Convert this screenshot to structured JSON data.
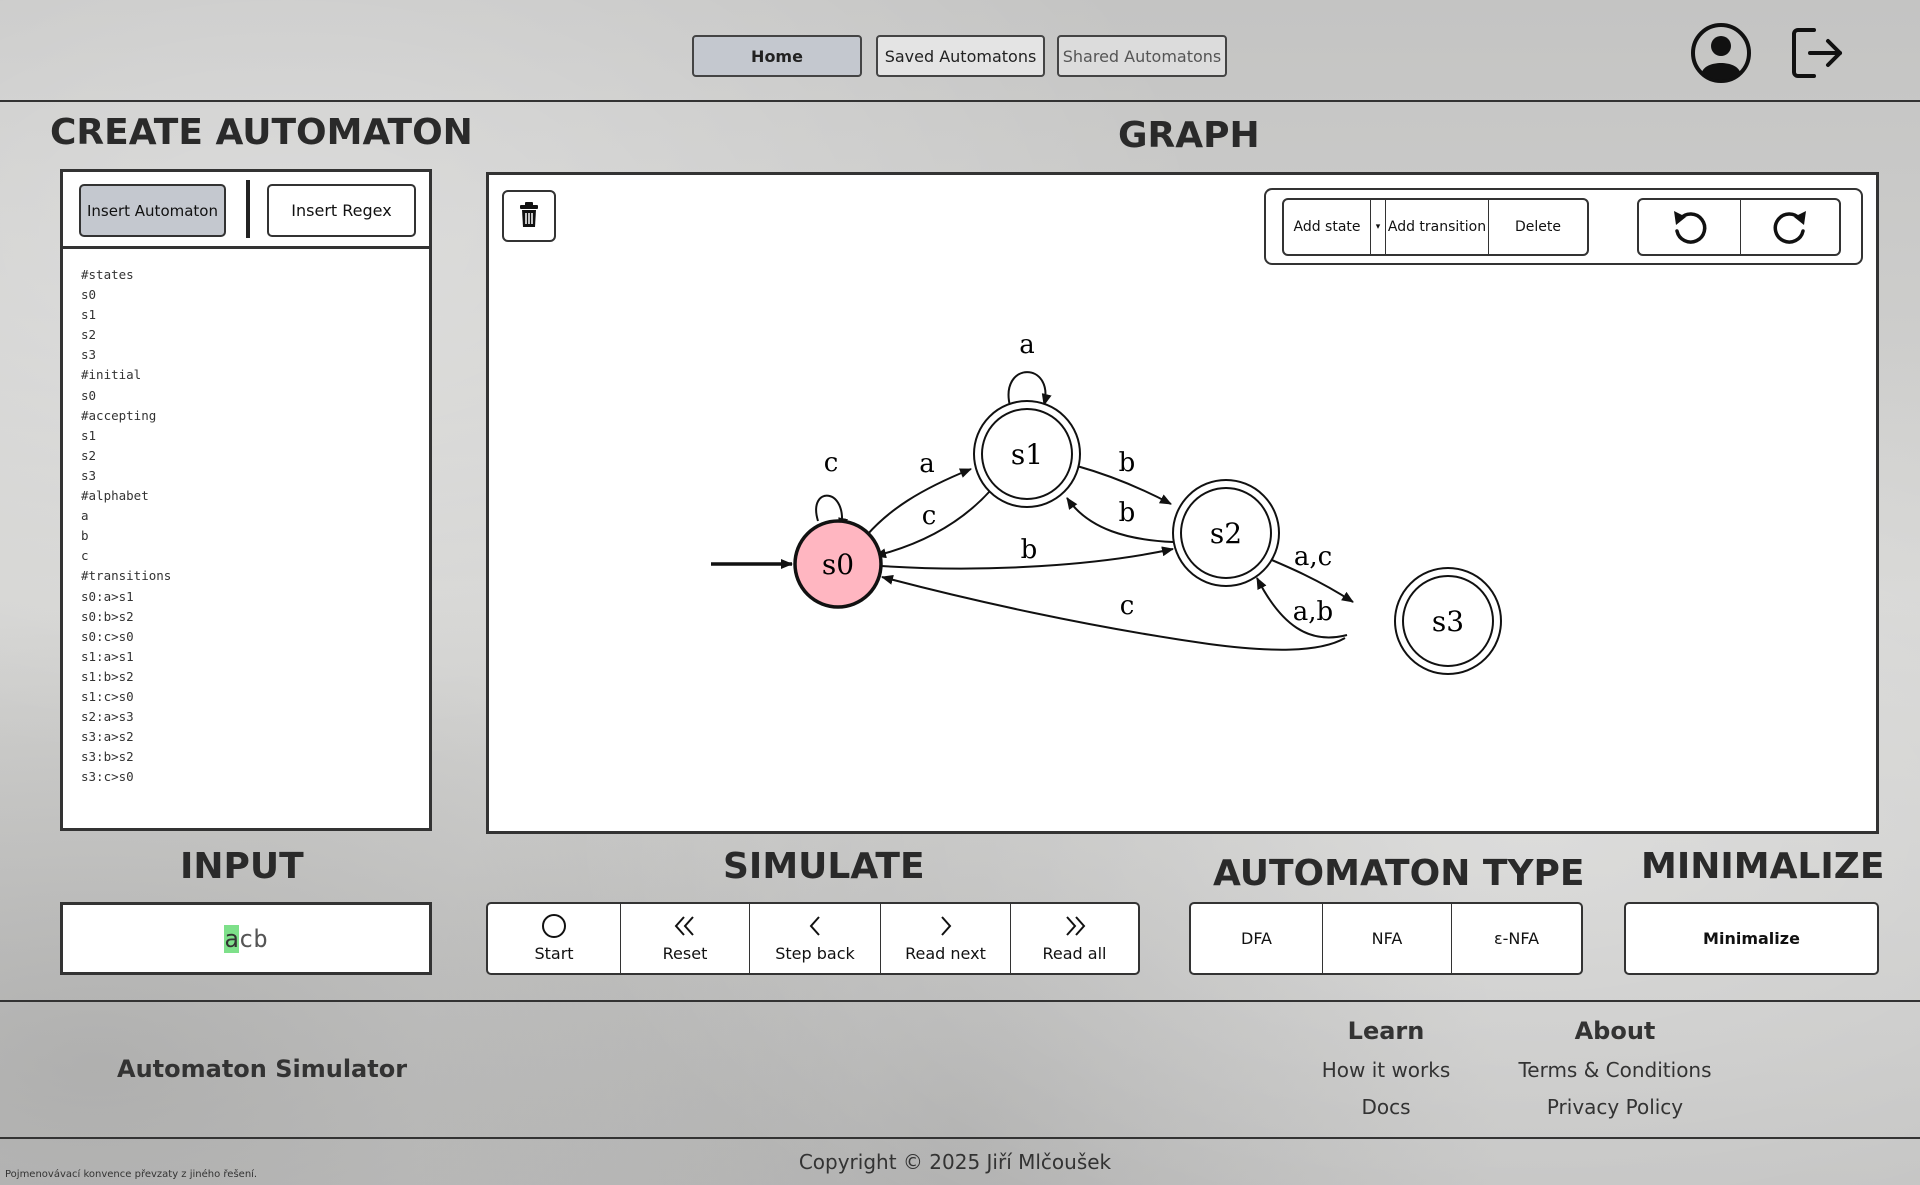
{
  "nav": {
    "home": "Home",
    "saved": "Saved Automatons",
    "shared": "Shared Automatons",
    "profile_icon": "user-circle-icon",
    "logout_icon": "logout-icon"
  },
  "create": {
    "title": "CREATE AUTOMATON",
    "insert_automaton": "Insert Automaton",
    "insert_regex": "Insert Regex",
    "definition_lines": [
      "#states",
      "s0",
      "s1",
      "s2",
      "s3",
      "#initial",
      "s0",
      "#accepting",
      "s1",
      "s2",
      "s3",
      "#alphabet",
      "a",
      "b",
      "c",
      "#transitions",
      "s0:a>s1",
      "s0:b>s2",
      "s0:c>s0",
      "s1:a>s1",
      "s1:b>s2",
      "s1:c>s0",
      "s2:a>s3",
      "s3:a>s2",
      "s3:b>s2",
      "s3:c>s0"
    ]
  },
  "graph": {
    "title": "GRAPH",
    "trash_icon": "trash-icon",
    "add_state": "Add state",
    "dropdown_icon": "caret-down-icon",
    "add_transition": "Add transition",
    "delete": "Delete",
    "undo_icon": "undo-icon",
    "redo_icon": "redo-icon",
    "states": {
      "s0": "s0",
      "s1": "s1",
      "s2": "s2",
      "s3": "s3"
    },
    "edge_labels": {
      "s0_s0": "c",
      "s0_s1": "a",
      "s1_s0": "c",
      "s1_s1": "a",
      "s1_s2": "b",
      "s2_s1": "b",
      "s0_s2": "b",
      "s2_s3": "a,c",
      "s3_s2": "a,b",
      "s3_s0": "c"
    },
    "initial_state_color": "#ffb6c1"
  },
  "input": {
    "title": "INPUT",
    "current_char": "a",
    "rest": "cb",
    "highlight_color": "#7ee08a"
  },
  "simulate": {
    "title": "SIMULATE",
    "start": "Start",
    "reset": "Reset",
    "step_back": "Step back",
    "read_next": "Read next",
    "read_all": "Read all",
    "start_icon": "circle-icon",
    "reset_icon": "double-chevron-left-icon",
    "step_back_icon": "chevron-left-icon",
    "read_next_icon": "chevron-right-icon",
    "read_all_icon": "double-chevron-right-icon"
  },
  "type": {
    "title": "AUTOMATON TYPE",
    "dfa": "DFA",
    "nfa": "NFA",
    "enfa": "ε-NFA"
  },
  "minimalize": {
    "title": "MINIMALIZE",
    "button": "Minimalize"
  },
  "footer": {
    "brand": "Automaton Simulator",
    "learn_heading": "Learn",
    "how_it_works": "How it works",
    "docs": "Docs",
    "about_heading": "About",
    "terms": "Terms & Conditions",
    "privacy": "Privacy Policy",
    "copyright": "Copyright © 2025 Jiří Mlčoušek",
    "note": "Pojmenovávací konvence převzaty z jiného řešení."
  }
}
